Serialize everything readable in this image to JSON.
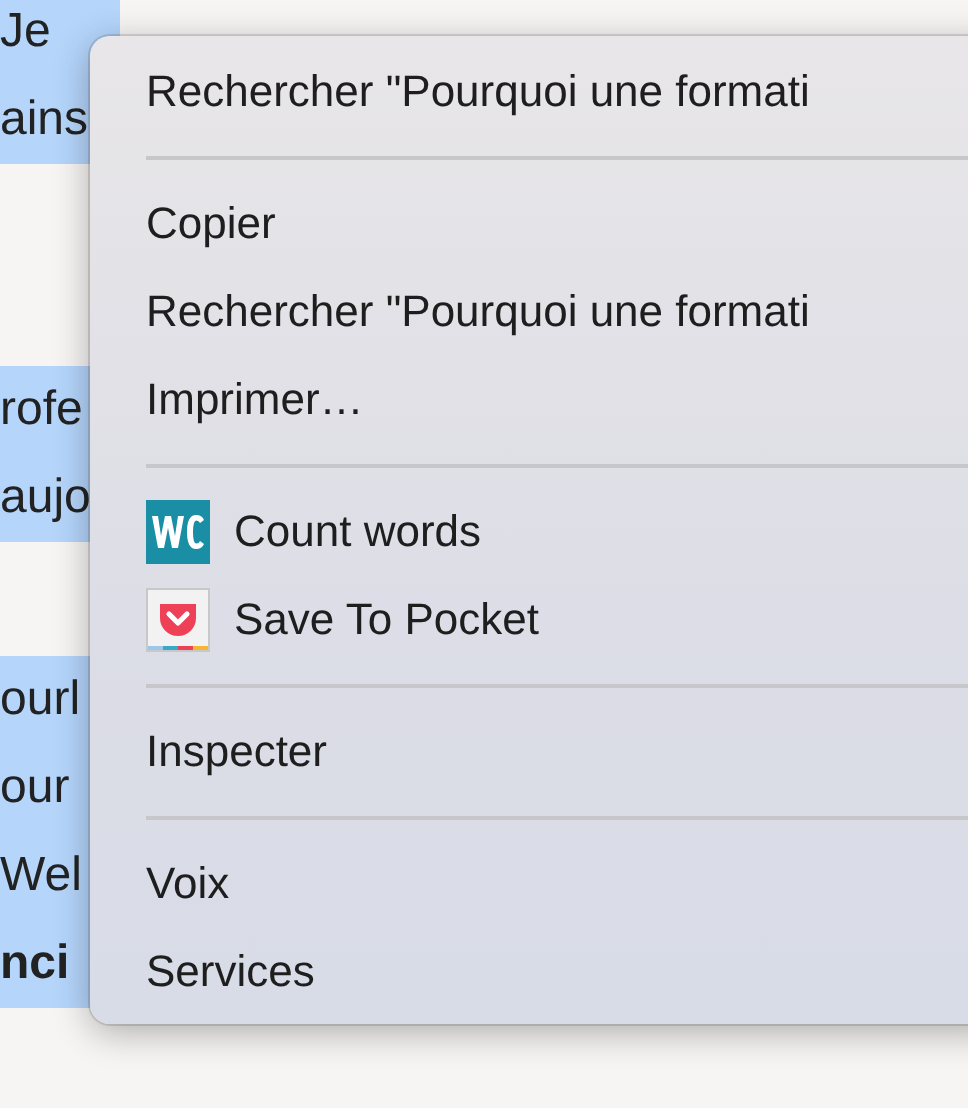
{
  "page": {
    "paragraphs": [
      {
        "selected": true,
        "lines": [
          {
            "text": "Je"
          },
          {
            "text": "ains"
          }
        ]
      },
      {
        "selected": true,
        "lines": [
          {
            "text": "rofe"
          },
          {
            "text": "aujo"
          }
        ]
      },
      {
        "selected": true,
        "lines": [
          {
            "text": "ourl"
          },
          {
            "text": "our"
          },
          {
            "text": "Wel"
          },
          {
            "text": "nci",
            "bold": true
          }
        ]
      }
    ]
  },
  "context_menu": {
    "sections": [
      [
        {
          "label": "Rechercher \"Pourquoi une formati"
        }
      ],
      [
        {
          "label": "Copier"
        },
        {
          "label": "Rechercher \"Pourquoi une formati"
        },
        {
          "label": "Imprimer…"
        }
      ],
      [
        {
          "label": "Count words",
          "kind": "wc"
        },
        {
          "label": "Save To Pocket",
          "kind": "pocket"
        }
      ],
      [
        {
          "label": "Inspecter"
        }
      ],
      [
        {
          "label": "Voix"
        },
        {
          "label": "Services"
        }
      ]
    ]
  }
}
